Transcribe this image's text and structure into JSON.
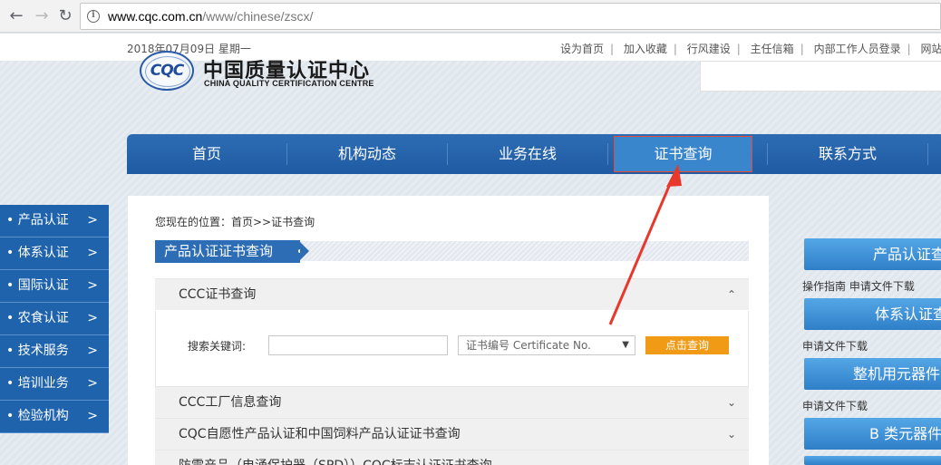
{
  "browser": {
    "url_host": "www.cqc.com.cn",
    "url_path": "/www/chinese/zscx/"
  },
  "topbar": {
    "date": "2018年07月09日  星期一",
    "links": [
      "设为首页",
      "加入收藏",
      "行风建设",
      "主任信箱",
      "内部工作人员登录",
      "网站"
    ]
  },
  "logo": {
    "emblem": "CQC",
    "name_cn": "中国质量认证中心",
    "name_en": "CHINA QUALITY CERTIFICATION CENTRE"
  },
  "mainnav": {
    "items": [
      "首页",
      "机构动态",
      "业务在线",
      "证书查询",
      "联系方式"
    ],
    "active": "证书查询"
  },
  "leftmenu": {
    "items": [
      "• 产品认证",
      "• 体系认证",
      "• 国际认证",
      "• 农食认证",
      "• 技术服务",
      "• 培训业务",
      "• 检验机构"
    ],
    "arrow": ">"
  },
  "content": {
    "breadcrumb": "您现在的位置：首页>>证书查询",
    "section_title": "产品认证证书查询",
    "accordion": [
      {
        "title": "CCC证书查询",
        "chevron": "⌃"
      },
      {
        "title": "CCC工厂信息查询",
        "chevron": "⌄"
      },
      {
        "title": "CQC自愿性产品认证和中国饲料产品认证证书查询",
        "chevron": "⌄"
      },
      {
        "title": "防雷产品（电涌保护器（SPD））CQC标志认证证书查询",
        "chevron": "⌄"
      }
    ],
    "search_label": "搜索关键词:",
    "select_value": "证书编号 Certificate No.",
    "search_button": "点击查询"
  },
  "right": {
    "buttons": [
      "产品认证查",
      "体系认证查",
      "整机用元器件",
      "B 类元器件"
    ],
    "links_1": "操作指南    申请文件下载",
    "links_2": "申请文件下载",
    "links_3": "申请文件下载"
  },
  "colors": {
    "nav_blue": "#1f5ba3",
    "accent_orange": "#f19a16",
    "annotation_red": "#e8372b"
  }
}
